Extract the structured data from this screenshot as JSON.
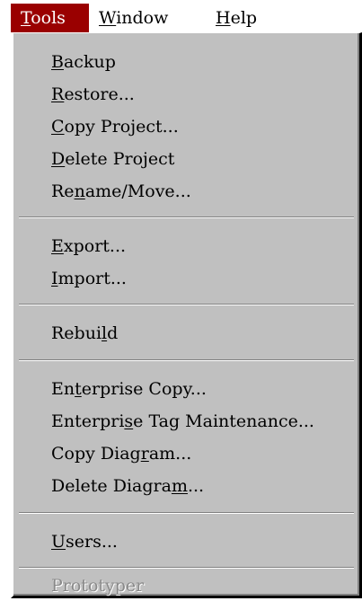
{
  "menubar": {
    "items": [
      {
        "pre": "",
        "key": "T",
        "post": "ools",
        "active": true
      },
      {
        "pre": "",
        "key": "W",
        "post": "indow",
        "active": false
      },
      {
        "pre": "",
        "key": "H",
        "post": "elp",
        "active": false
      }
    ]
  },
  "tools_menu": {
    "items": [
      {
        "pre": "",
        "key": "B",
        "post": "ackup"
      },
      {
        "pre": "",
        "key": "R",
        "post": "estore..."
      },
      {
        "pre": "",
        "key": "C",
        "post": "opy Project..."
      },
      {
        "pre": "",
        "key": "D",
        "post": "elete Project"
      },
      {
        "pre": "Re",
        "key": "n",
        "post": "ame/Move..."
      },
      {
        "pre": "",
        "key": "E",
        "post": "xport..."
      },
      {
        "pre": "",
        "key": "I",
        "post": "mport..."
      },
      {
        "pre": "Rebui",
        "key": "l",
        "post": "d"
      },
      {
        "pre": "En",
        "key": "t",
        "post": "erprise Copy..."
      },
      {
        "pre": "Enterpri",
        "key": "s",
        "post": "e Tag Maintenance..."
      },
      {
        "pre": "Copy Diag",
        "key": "r",
        "post": "am..."
      },
      {
        "pre": "Delete Diagra",
        "key": "m",
        "post": "..."
      },
      {
        "pre": "",
        "key": "U",
        "post": "sers..."
      },
      {
        "pre": "Prototyper",
        "key": "",
        "post": "",
        "disabled": true
      }
    ]
  },
  "colors": {
    "menu_background": "#c0c0c0",
    "active_menu_highlight": "#9a0000",
    "disabled_text": "#8a8a8a"
  }
}
